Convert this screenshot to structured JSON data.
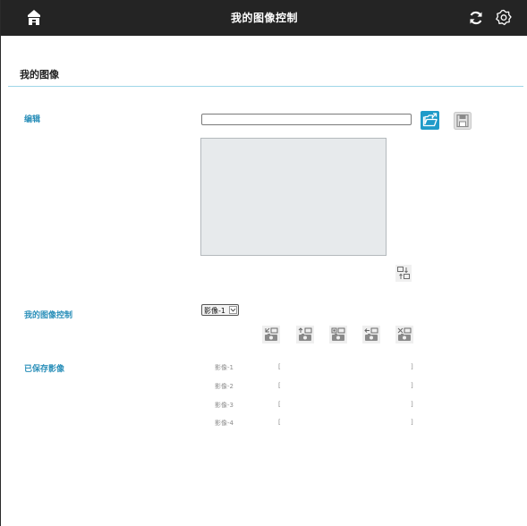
{
  "app": {
    "title": "我的图像控制"
  },
  "page": {
    "title": "我的图像"
  },
  "icons": {
    "home": "home-icon",
    "refresh": "refresh-icon",
    "settings": "gear-icon",
    "open": "open-folder-icon",
    "save": "save-disk-icon",
    "swap": "swap-image-icon"
  },
  "colors": {
    "topbar": "#242424",
    "accent": "#2a8fb9",
    "rule": "#9fd6e8",
    "open_button": "#1f9bc9"
  },
  "edit": {
    "label": "编辑",
    "path_value": "",
    "path_placeholder": ""
  },
  "control": {
    "label": "我的图像控制",
    "selected_image": "影像-1",
    "buttons": [
      "image-action-1-icon",
      "image-action-2-icon",
      "image-action-3-icon",
      "image-action-4-icon",
      "image-delete-icon"
    ]
  },
  "saved": {
    "label": "已保存影像",
    "items": [
      {
        "name": "影像-1",
        "open": "[",
        "close": "]"
      },
      {
        "name": "影像-2",
        "open": "[",
        "close": "]"
      },
      {
        "name": "影像-3",
        "open": "[",
        "close": "]"
      },
      {
        "name": "影像-4",
        "open": "[",
        "close": "]"
      }
    ]
  }
}
